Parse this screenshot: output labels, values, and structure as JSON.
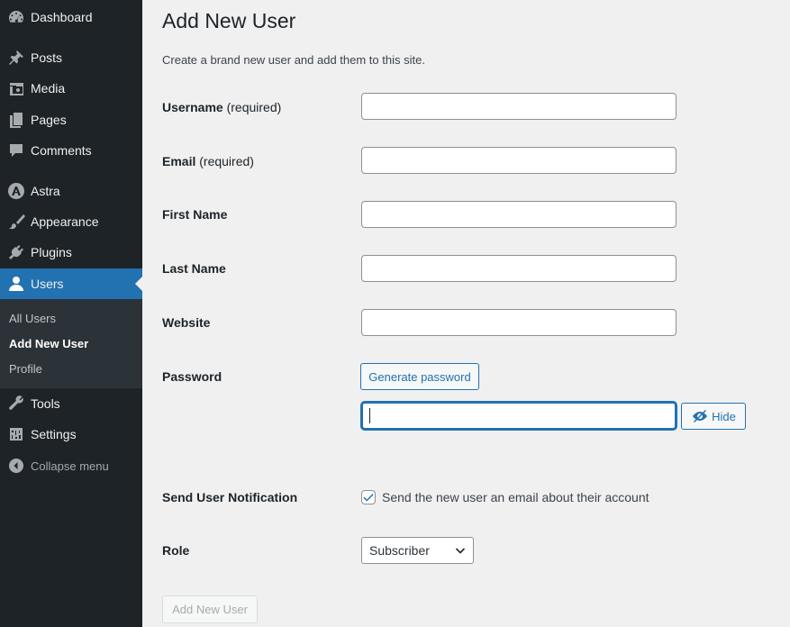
{
  "sidebar": {
    "items": [
      {
        "label": "Dashboard",
        "icon": "dashboard-icon"
      },
      {
        "label": "Posts",
        "icon": "pin-icon"
      },
      {
        "label": "Media",
        "icon": "media-icon"
      },
      {
        "label": "Pages",
        "icon": "pages-icon"
      },
      {
        "label": "Comments",
        "icon": "comment-icon"
      },
      {
        "label": "Astra",
        "icon": "astra-icon"
      },
      {
        "label": "Appearance",
        "icon": "paintbrush-icon"
      },
      {
        "label": "Plugins",
        "icon": "plugin-icon"
      },
      {
        "label": "Users",
        "icon": "user-icon"
      },
      {
        "label": "Tools",
        "icon": "wrench-icon"
      },
      {
        "label": "Settings",
        "icon": "settings-sliders-icon"
      }
    ],
    "submenu": [
      "All Users",
      "Add New User",
      "Profile"
    ],
    "collapse_label": "Collapse menu",
    "colors": {
      "background": "#1d2327",
      "active": "#2271b1",
      "submenu": "#2c3338"
    }
  },
  "main": {
    "title": "Add New User",
    "intro": "Create a brand new user and add them to this site.",
    "fields": {
      "username_label": "Username",
      "email_label": "Email",
      "required_note": "(required)",
      "first_name_label": "First Name",
      "last_name_label": "Last Name",
      "website_label": "Website",
      "password_label": "Password"
    },
    "generate_password_label": "Generate password",
    "hide_label": "Hide",
    "notification_label": "Send User Notification",
    "notification_text": "Send the new user an email about their account",
    "notification_checked": true,
    "role_label": "Role",
    "role_selected": "Subscriber",
    "submit_label": "Add New User"
  }
}
